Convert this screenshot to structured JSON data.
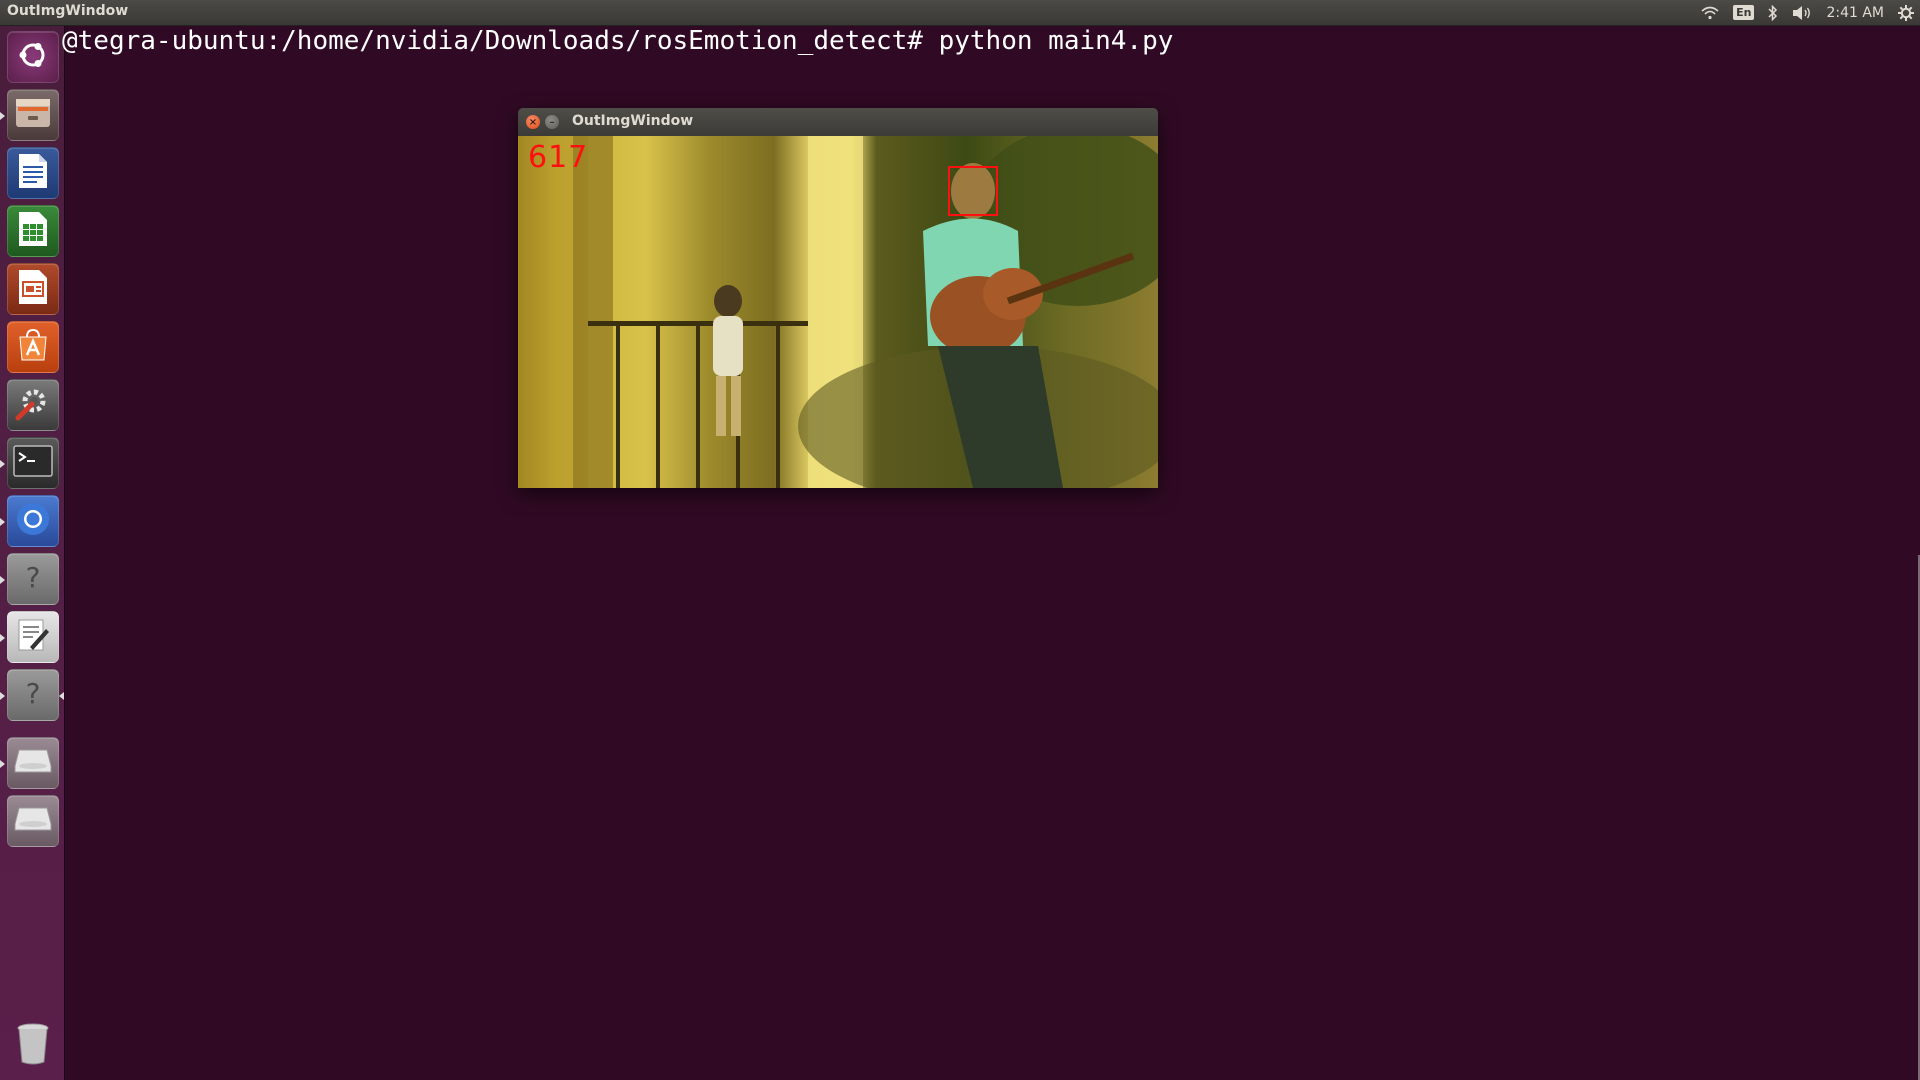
{
  "top_panel": {
    "window_title": "OutImgWindow",
    "keyboard_layout": "En",
    "clock": "2:41 AM",
    "icons": [
      "wifi-icon",
      "keyboard-layout-icon",
      "bluetooth-icon",
      "volume-icon",
      "gear-icon"
    ]
  },
  "launcher": {
    "items": [
      {
        "name": "ubuntu-dash-icon"
      },
      {
        "name": "files-icon"
      },
      {
        "name": "writer-icon"
      },
      {
        "name": "calc-icon"
      },
      {
        "name": "impress-icon"
      },
      {
        "name": "software-center-icon"
      },
      {
        "name": "system-settings-icon"
      },
      {
        "name": "terminal-icon"
      },
      {
        "name": "chromium-icon"
      },
      {
        "name": "unknown-app-icon"
      },
      {
        "name": "text-editor-icon"
      },
      {
        "name": "unknown-app-icon"
      },
      {
        "name": "drive-icon"
      },
      {
        "name": "drive-icon"
      },
      {
        "name": "trash-icon"
      }
    ]
  },
  "terminal": {
    "prompt_line": "@tegra-ubuntu:/home/nvidia/Downloads/rosEmotion_detect# python main4.py"
  },
  "cv_window": {
    "title": "OutImgWindow",
    "close_glyph": "×",
    "minimize_glyph": "–",
    "frame_counter": "617"
  },
  "colors": {
    "desktop_bg": "#300a24",
    "overlay_red": "#ff1010"
  }
}
